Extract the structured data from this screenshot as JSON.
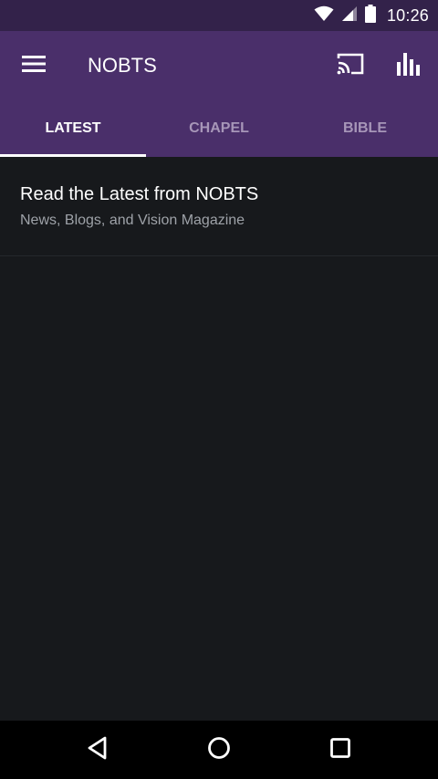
{
  "status_bar": {
    "time": "10:26",
    "icons": [
      "wifi-icon",
      "cell-signal-icon",
      "battery-icon"
    ]
  },
  "app_bar": {
    "title": "NOBTS",
    "icons": [
      "menu-icon",
      "cast-icon",
      "bar-chart-icon"
    ]
  },
  "tabs": [
    {
      "label": "LATEST",
      "active": true
    },
    {
      "label": "CHAPEL",
      "active": false
    },
    {
      "label": "BIBLE",
      "active": false
    }
  ],
  "list": [
    {
      "title": "Read the Latest from NOBTS",
      "subtitle": "News, Blogs, and Vision Magazine"
    }
  ],
  "nav_bar": {
    "icons": [
      "back-icon",
      "home-icon",
      "recents-icon"
    ]
  },
  "colors": {
    "status_bar": "#33224a",
    "app_bar": "#4a2f6a",
    "background": "#17191c",
    "tab_inactive": "#a796b8",
    "subtitle": "#9ea2a8"
  }
}
